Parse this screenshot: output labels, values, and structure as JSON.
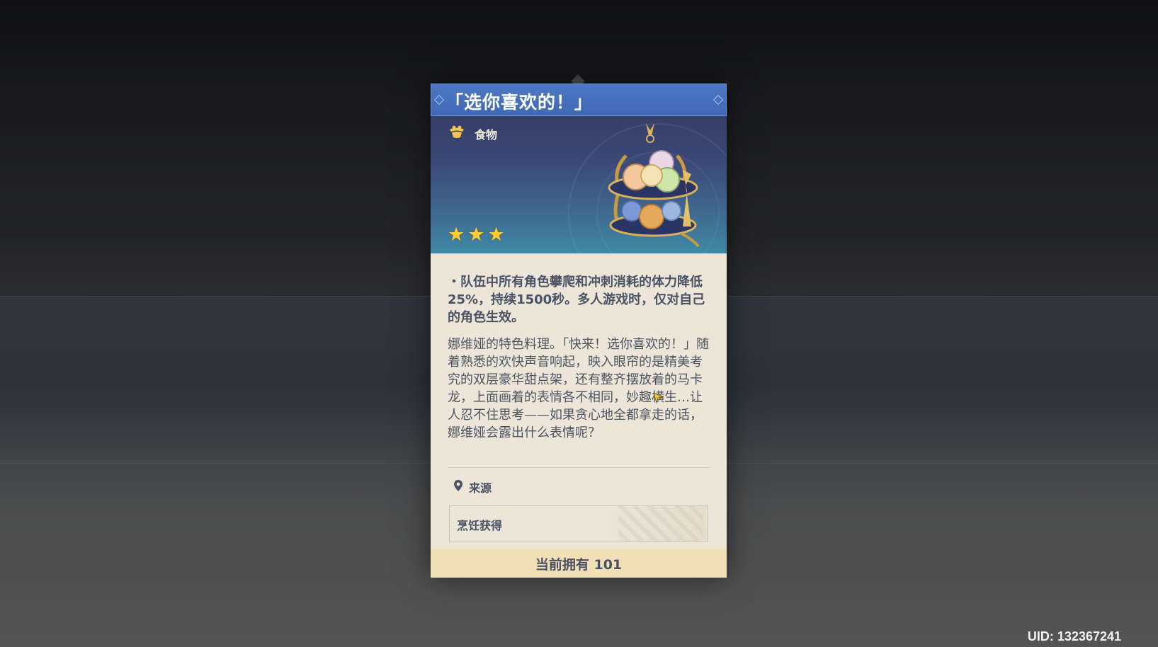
{
  "item": {
    "title": "「选你喜欢的！」",
    "type_label": "食物",
    "type_icon": "food-icon",
    "rarity_stars": 3,
    "effect": "・队伍中所有角色攀爬和冲刺消耗的体力降低25%，持续1500秒。多人游戏时，仅对自己的角色生效。",
    "lore": "娜维娅的特色料理。「快来！选你喜欢的！」随着熟悉的欢快声音响起，映入眼帘的是精美考究的双层豪华甜点架，还有整齐摆放着的马卡龙，上面画着的表情各不相同，妙趣横生…让人忍不住思考——如果贪心地全都拿走的话，娜维娅会露出什么表情呢？",
    "source_title": "来源",
    "source_icon": "location-pin-icon",
    "source_value": "烹饪获得",
    "owned_label": "当前拥有 101",
    "image": "macaron-dessert-stand"
  },
  "uid_label": "UID: 132367241",
  "colors": {
    "title_bar": "#4e79c4",
    "desc_bg": "#ece5d8",
    "owned_bar": "#f3dfb5",
    "star": "#ffcc33",
    "text": "#4a5366"
  }
}
